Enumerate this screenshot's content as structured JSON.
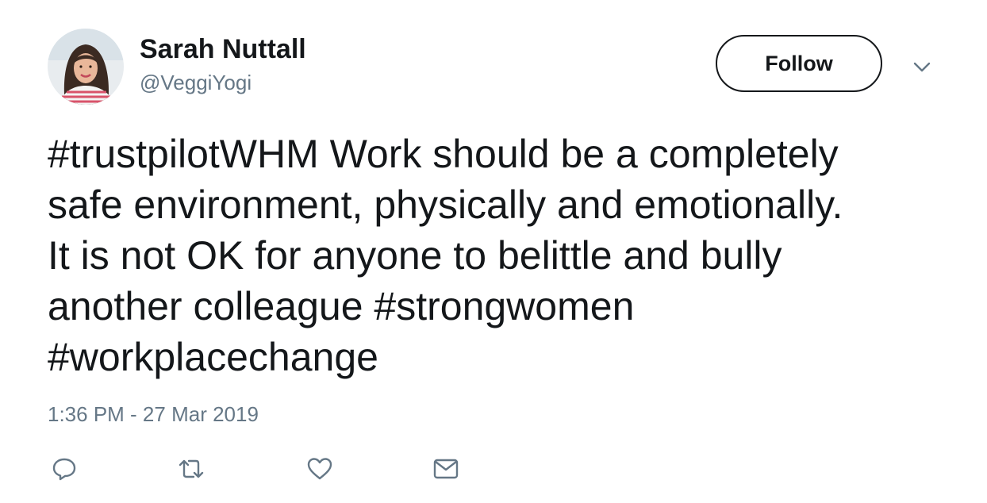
{
  "tweet": {
    "author": {
      "display_name": "Sarah Nuttall",
      "handle": "@VeggiYogi",
      "avatar_icon": "profile-photo"
    },
    "follow_label": "Follow",
    "more_icon": "chevron-down-icon",
    "text_lines": [
      "#trustpilotWHM Work should be a completely",
      "safe environment, physically and emotionally.",
      "It is not OK for anyone to belittle and bully",
      "another colleague #strongwomen",
      "#workplacechange"
    ],
    "timestamp": "1:36 PM - 27 Mar 2019",
    "actions": [
      {
        "name": "reply",
        "icon": "reply-icon"
      },
      {
        "name": "retweet",
        "icon": "retweet-icon"
      },
      {
        "name": "like",
        "icon": "heart-icon"
      },
      {
        "name": "direct-message",
        "icon": "envelope-icon"
      }
    ]
  },
  "colors": {
    "text_primary": "#14171a",
    "text_secondary": "#657786",
    "icon": "#657786"
  }
}
